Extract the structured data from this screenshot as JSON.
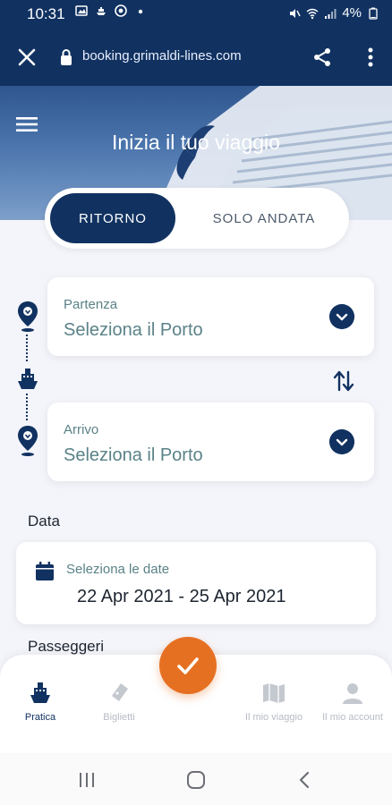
{
  "status_bar": {
    "time": "10:31",
    "battery": "4%"
  },
  "browser": {
    "url": "booking.grimaldi-lines.com"
  },
  "hero": {
    "title": "Inizia il tuo viaggio"
  },
  "trip_type": {
    "selected": "RITORNO",
    "other": "SOLO ANDATA"
  },
  "departure": {
    "label": "Partenza",
    "value": "Seleziona il Porto"
  },
  "arrival": {
    "label": "Arrivo",
    "value": "Seleziona il Porto"
  },
  "dates": {
    "section_label": "Data",
    "label": "Seleziona le date",
    "value": "22 Apr 2021 - 25 Apr 2021"
  },
  "passengers": {
    "section_label": "Passeggeri"
  },
  "bottom_nav": {
    "items": [
      {
        "label": "Pratica",
        "icon": "ship-icon",
        "active": true
      },
      {
        "label": "Biglietti",
        "icon": "ticket-icon",
        "active": false
      },
      {
        "label": "Il mio viaggio",
        "icon": "map-icon",
        "active": false
      },
      {
        "label": "Il mio account",
        "icon": "person-icon",
        "active": false
      }
    ]
  },
  "colors": {
    "brand_navy": "#113261",
    "accent_orange": "#e67022",
    "label_teal": "#5a8287"
  }
}
